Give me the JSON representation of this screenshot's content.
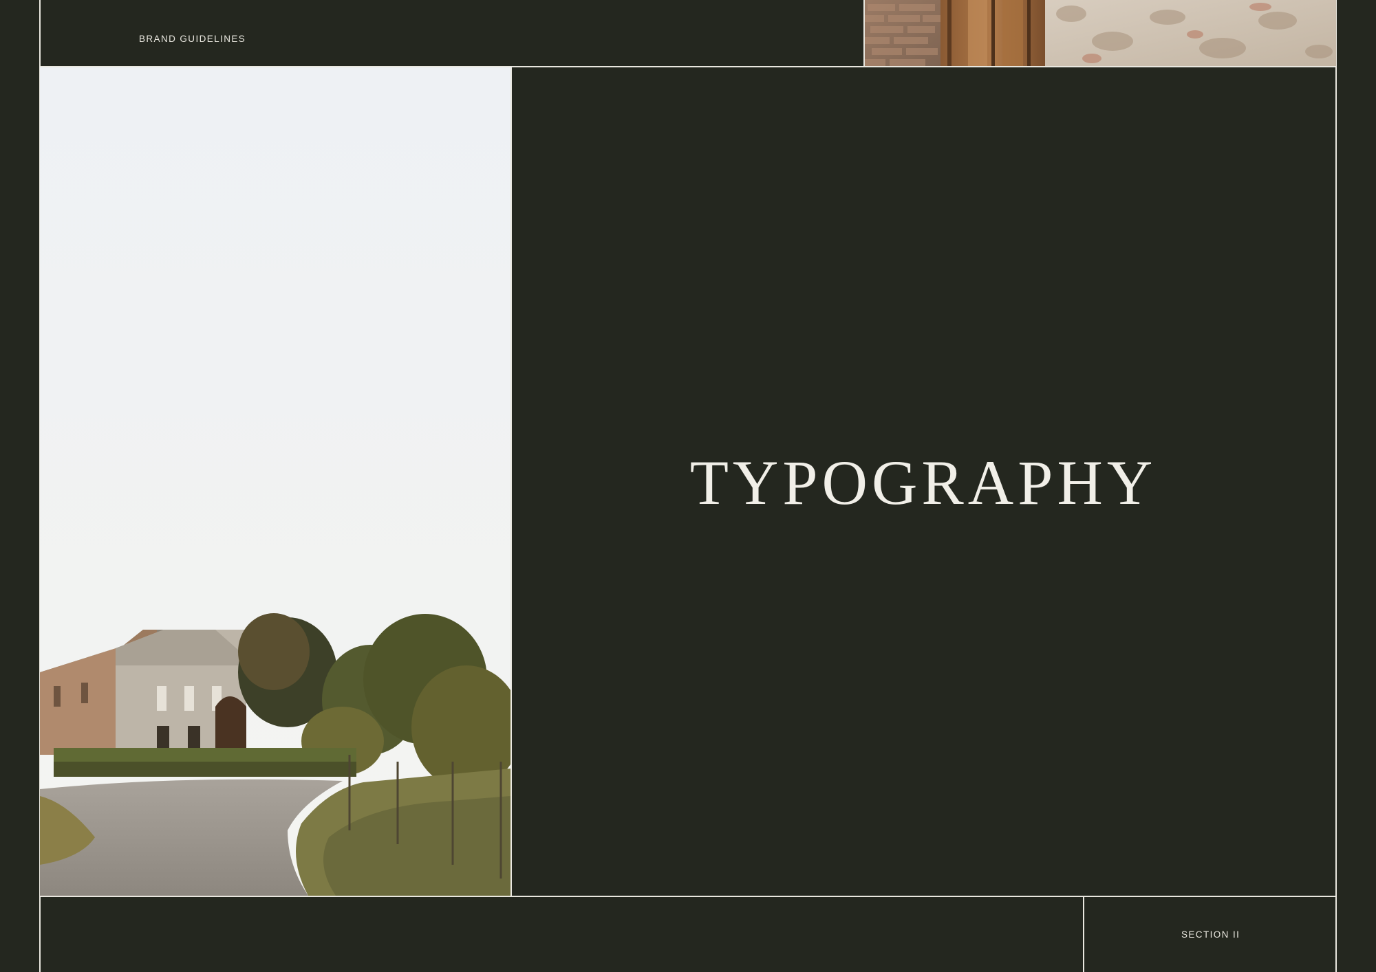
{
  "header": {
    "label": "BRAND GUIDELINES"
  },
  "main": {
    "title": "TYPOGRAPHY"
  },
  "footer": {
    "section_label": "SECTION II"
  },
  "colors": {
    "background": "#24271f",
    "rule_lines": "#e9e7df",
    "text": "#f1efe8",
    "sky": "#eef1f3"
  },
  "images": {
    "top_strip": "brick-and-wood-texture-photo",
    "main": "farmhouse-landscape-photo"
  }
}
